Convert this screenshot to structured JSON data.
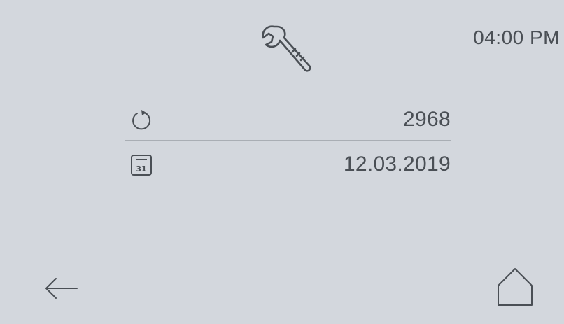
{
  "status_bar": {
    "time": "04:00 PM"
  },
  "header": {
    "icon": "wrench-icon"
  },
  "info_rows": [
    {
      "icon": "cycle-refresh-icon",
      "value": "2968"
    },
    {
      "icon": "calendar-icon",
      "calendar_day": "31",
      "value": "12.03.2019"
    }
  ],
  "navigation": {
    "back_icon": "arrow-left-icon",
    "home_icon": "home-icon"
  },
  "colors": {
    "background": "#d3d7dd",
    "text": "#4a4f55",
    "divider": "#a9aeb4"
  }
}
